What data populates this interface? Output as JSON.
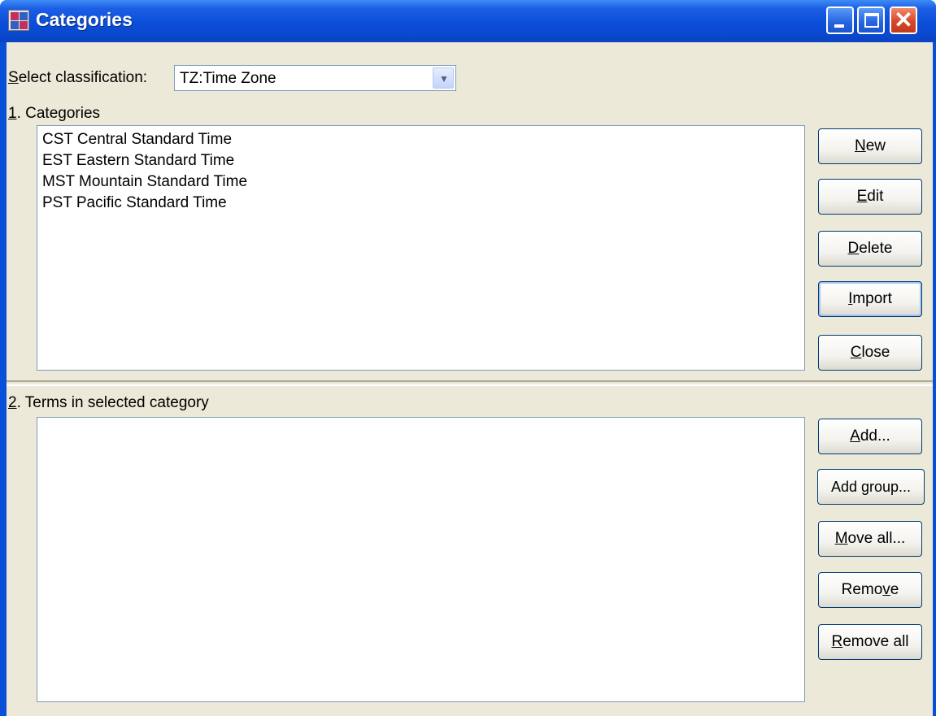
{
  "window": {
    "title": "Categories",
    "controls": {
      "minimize": "minimize",
      "maximize": "maximize",
      "close": "✕"
    }
  },
  "classification": {
    "label_key": "S",
    "label_rest": "elect classification:",
    "selected": "TZ:Time Zone"
  },
  "categories_section": {
    "label_key": "1",
    "label_rest": ". Categories",
    "items": [
      "CST Central Standard Time",
      "EST Eastern Standard Time",
      "MST Mountain Standard Time",
      "PST Pacific Standard Time"
    ],
    "buttons": {
      "new": {
        "key": "N",
        "rest": "ew"
      },
      "edit": {
        "key": "E",
        "rest": "dit"
      },
      "delete": {
        "key": "D",
        "rest": "elete"
      },
      "import": {
        "key": "I",
        "rest": "mport"
      },
      "close": {
        "key": "C",
        "rest": "lose"
      }
    }
  },
  "terms_section": {
    "label_key": "2",
    "label_rest": ". Terms in selected category",
    "items": [],
    "buttons": {
      "add": {
        "key": "A",
        "rest": "dd..."
      },
      "add_group": {
        "label": "Add group..."
      },
      "move_all": {
        "key": "M",
        "rest": "ove all..."
      },
      "remove": {
        "pre": "Remo",
        "key": "v",
        "rest": "e"
      },
      "remove_all": {
        "key": "R",
        "rest": "emove all"
      }
    }
  }
}
